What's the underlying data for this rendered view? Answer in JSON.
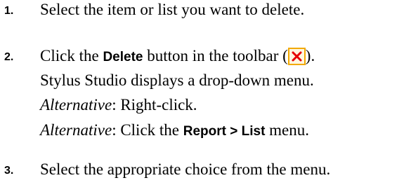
{
  "steps": [
    {
      "number": "1.",
      "lines": {
        "a": "Select the item or list you want to delete."
      }
    },
    {
      "number": "2.",
      "line1": {
        "pre": "Click the ",
        "ui": "Delete",
        "post": " button in the toolbar (",
        "close": ")."
      },
      "line2": "Stylus Studio displays a drop-down menu.",
      "line3": {
        "label": "Alternative",
        "text": ": Right-click."
      },
      "line4": {
        "label": "Alternative",
        "pre": ": Click the ",
        "ui": "Report > List",
        "post": " menu."
      }
    },
    {
      "number": "3.",
      "lines": {
        "a": "Select the appropriate choice from the menu."
      }
    }
  ],
  "icons": {
    "delete": "delete-x-icon",
    "accent": "#e60000",
    "border": "#f2a900"
  }
}
